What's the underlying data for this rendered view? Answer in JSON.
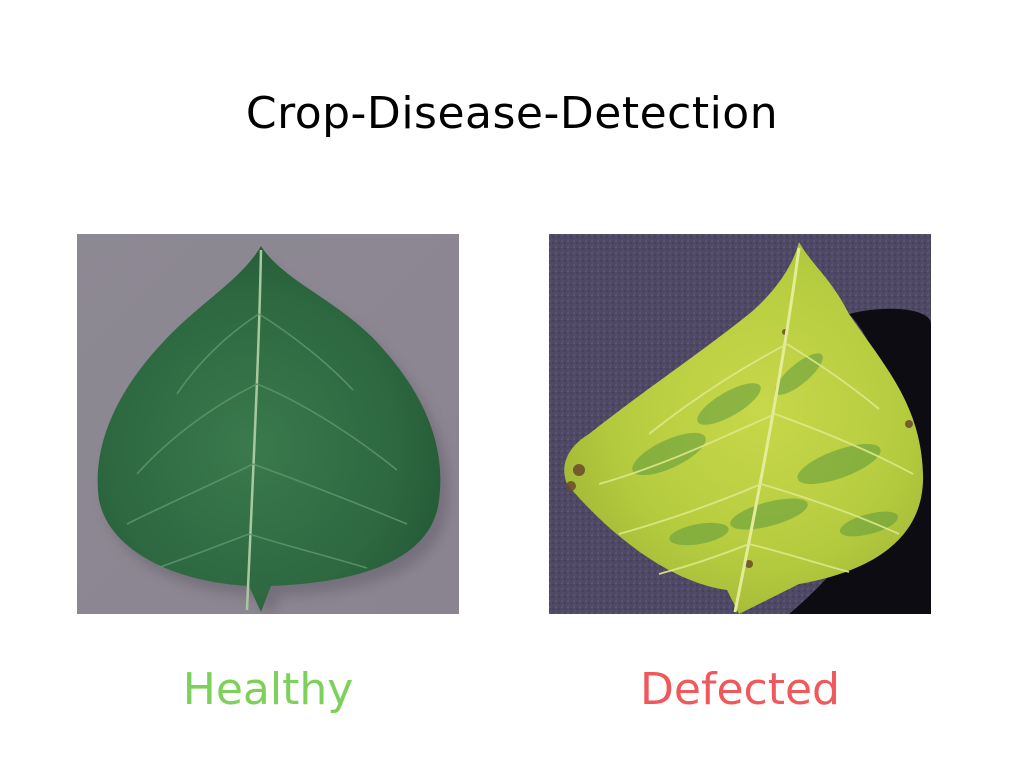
{
  "slide": {
    "title": "Crop-Disease-Detection"
  },
  "panels": [
    {
      "label": "Healthy",
      "label_color": "#7dd05a",
      "leaf_color": "#2f6a42",
      "background_color": "#8b8690"
    },
    {
      "label": "Defected",
      "label_color": "#f0585c",
      "leaf_color": "#b9cf45",
      "background_color": "#4d4763"
    }
  ],
  "icons": {
    "healthy": "leaf-photo",
    "defected": "leaf-photo"
  }
}
